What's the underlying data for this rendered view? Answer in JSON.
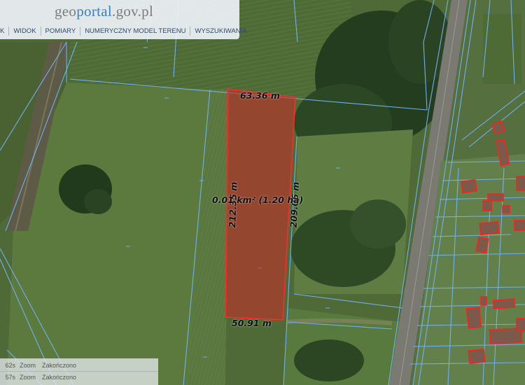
{
  "site": {
    "logo_pre": "geo",
    "logo_mid": "portal",
    "logo_suf": ".gov.pl"
  },
  "menu": {
    "items": [
      {
        "label": "K"
      },
      {
        "label": "WIDOK"
      },
      {
        "label": "POMIARY"
      },
      {
        "label": "NUMERYCZNY MODEL TERENU"
      },
      {
        "label": "WYSZUKIWANIA"
      }
    ]
  },
  "measurement": {
    "top_edge": "63.36 m",
    "left_edge": "212.35 m",
    "right_edge": "209.06 m",
    "bottom_edge": "50.91 m",
    "area": "0.01 km² (1.20 ha)",
    "fill_color": "#c0312b",
    "stroke_color": "#ff2a2a"
  },
  "log": {
    "rows": [
      {
        "time": "62s",
        "action": "Zoom",
        "status": "Zakończono"
      },
      {
        "time": "57s",
        "action": "Zoom",
        "status": "Zakończono"
      }
    ]
  },
  "colors": {
    "parcel_line": "#6fb0f0",
    "building_outline": "#ff1f1f"
  }
}
